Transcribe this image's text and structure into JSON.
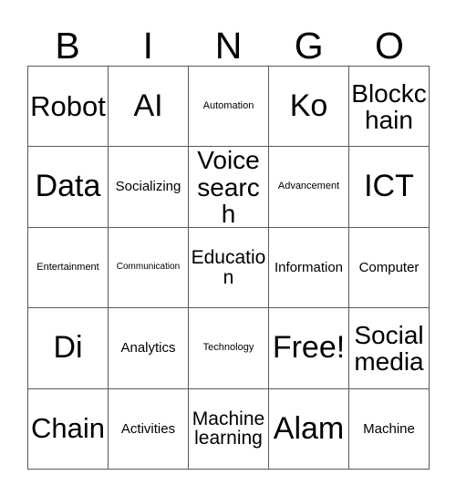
{
  "card": {
    "header": {
      "letters": [
        "B",
        "I",
        "N",
        "G",
        "O"
      ]
    },
    "rows": [
      [
        {
          "label": "Robot",
          "size": "lg"
        },
        {
          "label": "AI",
          "size": "xl"
        },
        {
          "label": "Automation",
          "size": "xxs"
        },
        {
          "label": "Ko",
          "size": "xl"
        },
        {
          "label": "Blockchain",
          "size": "md"
        }
      ],
      [
        {
          "label": "Data",
          "size": "xl"
        },
        {
          "label": "Socializing",
          "size": "xs"
        },
        {
          "label": "Voice search",
          "size": "md"
        },
        {
          "label": "Advancement",
          "size": "xxs"
        },
        {
          "label": "ICT",
          "size": "xl"
        }
      ],
      [
        {
          "label": "Entertainment",
          "size": "xxs"
        },
        {
          "label": "Communication",
          "size": "xxxs"
        },
        {
          "label": "Education",
          "size": "sm"
        },
        {
          "label": "Information",
          "size": "xs"
        },
        {
          "label": "Computer",
          "size": "xs"
        }
      ],
      [
        {
          "label": "Di",
          "size": "xl"
        },
        {
          "label": "Analytics",
          "size": "xs"
        },
        {
          "label": "Technology",
          "size": "xxs"
        },
        {
          "label": "Free!",
          "size": "xl"
        },
        {
          "label": "Social media",
          "size": "md"
        }
      ],
      [
        {
          "label": "Chain",
          "size": "lg"
        },
        {
          "label": "Activities",
          "size": "xs"
        },
        {
          "label": "Machine learning",
          "size": "sm"
        },
        {
          "label": "Alam",
          "size": "xl"
        },
        {
          "label": "Machine",
          "size": "xs"
        }
      ]
    ]
  },
  "colors": {
    "background": "#ffffff",
    "text": "#000000",
    "grid_line": "#5a5a5a"
  }
}
